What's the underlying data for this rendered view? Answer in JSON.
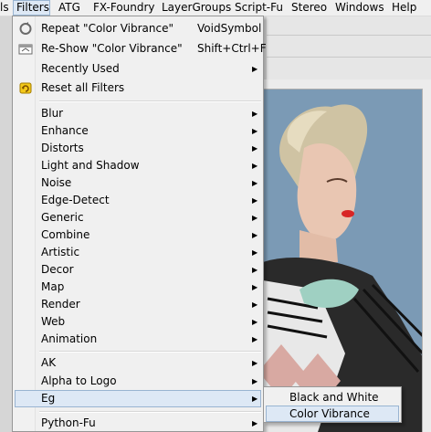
{
  "menubar": {
    "items": [
      "ls",
      "Filters",
      "ATG",
      "FX-Foundry",
      "LayerGroups",
      "Script-Fu",
      "Stereo",
      "Windows",
      "Help"
    ]
  },
  "filters_menu": {
    "repeat_label": "Repeat \"Color Vibrance\"",
    "repeat_shortcut": "VoidSymbol",
    "reshow_label": "Re-Show \"Color Vibrance\"",
    "reshow_shortcut": "Shift+Ctrl+F",
    "recently_used": "Recently Used",
    "reset_all": "Reset all Filters",
    "categories": [
      "Blur",
      "Enhance",
      "Distorts",
      "Light and Shadow",
      "Noise",
      "Edge-Detect",
      "Generic",
      "Combine",
      "Artistic",
      "Decor",
      "Map",
      "Render",
      "Web",
      "Animation"
    ],
    "extras": [
      "AK",
      "Alpha to Logo",
      "Eg"
    ],
    "python_fu": "Python-Fu"
  },
  "eg_submenu": {
    "items": [
      "Black and White",
      "Color Vibrance"
    ]
  },
  "colors": {
    "menu_bg": "#f0f0f0",
    "highlight": "#dde8f5",
    "highlight_border": "#99b4d1",
    "canvas_bg": "#7d9bb4"
  },
  "icons": {
    "repeat": "repeat-filter-icon",
    "reshow": "reshow-filter-icon",
    "reset": "reset-filters-icon",
    "arrow": "submenu-arrow-icon"
  }
}
